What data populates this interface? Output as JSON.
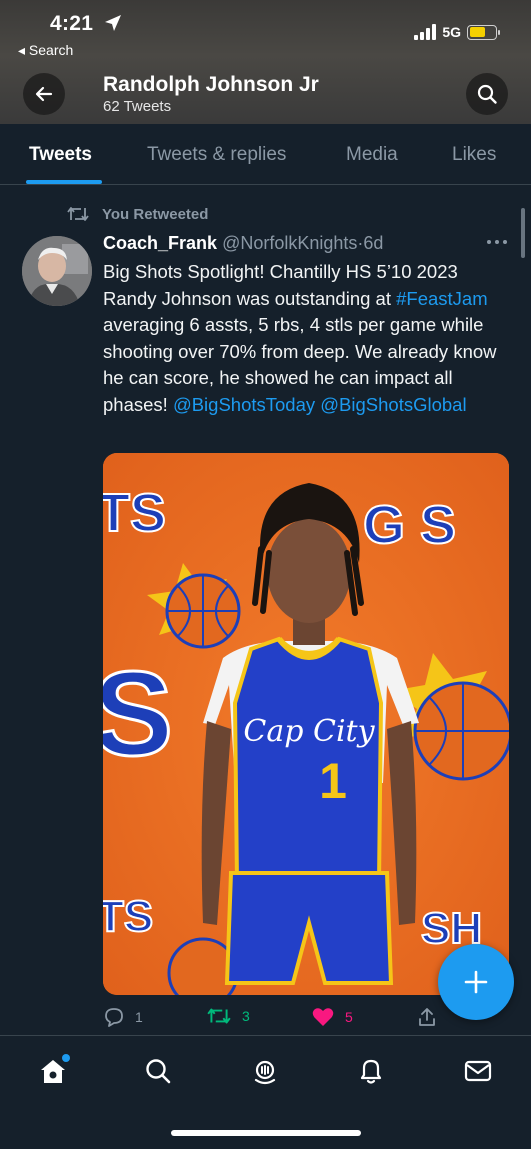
{
  "status_bar": {
    "time": "4:21",
    "back_app": "◂ Search",
    "network": "5G"
  },
  "header": {
    "title": "Randolph Johnson Jr",
    "subtitle": "62 Tweets"
  },
  "tabs": [
    {
      "label": "Tweets",
      "active": true
    },
    {
      "label": "Tweets & replies",
      "active": false
    },
    {
      "label": "Media",
      "active": false
    },
    {
      "label": "Likes",
      "active": false
    }
  ],
  "tweet": {
    "retweet_label": "You Retweeted",
    "author_name": "Coach_Frank",
    "author_handle": "@NorfolkKnights",
    "time_separator": "·",
    "timestamp": "6d",
    "text_segments": [
      {
        "text": "Big Shots Spotlight!  Chantilly HS 5’10 2023 Randy Johnson was outstanding at ",
        "link": false
      },
      {
        "text": "#FeastJam",
        "link": true
      },
      {
        "text": " averaging 6 assts, 5 rbs, 4 stls per game while shooting over 70% from deep.  We already know he can score, he showed he can impact all phases! ",
        "link": false
      },
      {
        "text": "@BigShotsToday",
        "link": true
      },
      {
        "text": " ",
        "link": false
      },
      {
        "text": "@BigShotsGlobal",
        "link": true
      }
    ],
    "image": {
      "banner_left": "TS",
      "banner_right": "G S",
      "bottom_left": "TS",
      "bottom_right": "SH",
      "big_letter": "S",
      "jersey_text": "Cap City",
      "jersey_number": "1"
    },
    "actions": {
      "reply_count": "1",
      "retweet_count": "3",
      "like_count": "5"
    }
  },
  "colors": {
    "background": "#15202b",
    "accent": "#1d9bf0",
    "retweet_green": "#00ba7c",
    "like_pink": "#f91880",
    "muted": "#8b98a5"
  },
  "icons": {
    "back": "arrow-left-icon",
    "search": "search-icon",
    "retweet": "retweet-icon",
    "more": "more-horizontal-icon",
    "reply": "reply-icon",
    "like": "heart-icon",
    "share": "share-icon",
    "compose": "plus-icon",
    "nav": [
      "home-icon",
      "search-icon",
      "spaces-icon",
      "bell-icon",
      "mail-icon"
    ]
  }
}
